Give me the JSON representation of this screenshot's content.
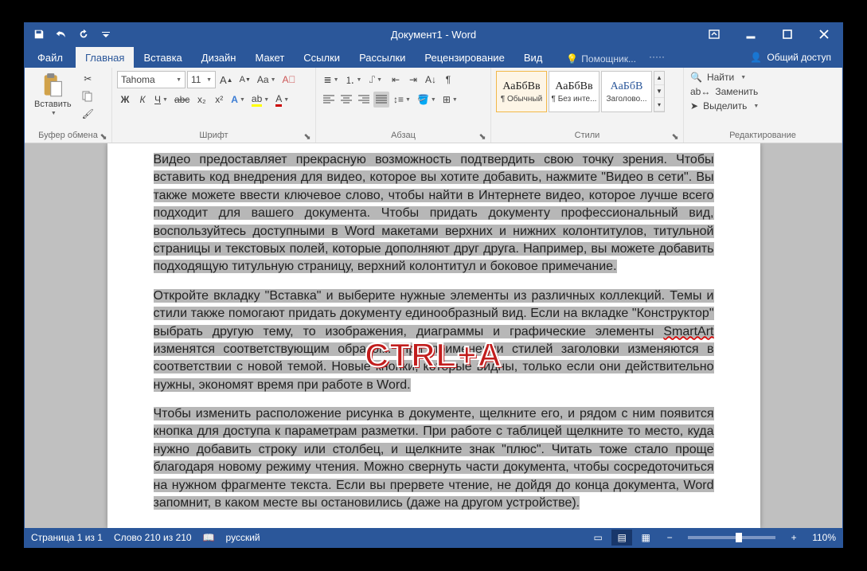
{
  "title": "Документ1 - Word",
  "tabs": {
    "file": "Файл",
    "home": "Главная",
    "insert": "Вставка",
    "design": "Дизайн",
    "layout": "Макет",
    "references": "Ссылки",
    "mailings": "Рассылки",
    "review": "Рецензирование",
    "view": "Вид"
  },
  "tellme": "Помощник...",
  "share": "Общий доступ",
  "ribbon": {
    "clipboard": {
      "label": "Буфер обмена",
      "paste": "Вставить"
    },
    "font": {
      "label": "Шрифт",
      "name": "Tahoma",
      "size": "11",
      "bold": "Ж",
      "italic": "К",
      "underline": "Ч",
      "strike": "abc",
      "sub": "x₂",
      "sup": "x²"
    },
    "paragraph": {
      "label": "Абзац"
    },
    "styles": {
      "label": "Стили",
      "items": [
        {
          "preview": "АаБбВв",
          "name": "¶ Обычный"
        },
        {
          "preview": "АаБбВв",
          "name": "¶ Без инте..."
        },
        {
          "preview": "АаБбВ",
          "name": "Заголово..."
        }
      ]
    },
    "editing": {
      "label": "Редактирование",
      "find": "Найти",
      "replace": "Заменить",
      "select": "Выделить"
    }
  },
  "document": {
    "p1": "Видео предоставляет прекрасную возможность подтвердить свою точку зрения. Чтобы вставить код внедрения для видео, которое вы хотите добавить, нажмите \"Видео в сети\". Вы также можете ввести ключевое слово, чтобы найти в Интернете видео, которое лучше всего подходит для вашего документа. Чтобы придать документу профессиональный вид, воспользуйтесь доступными в Word макетами верхних и нижних колонтитулов, титульной страницы и текстовых полей, которые дополняют друг друга. Например, вы можете добавить подходящую титульную страницу, верхний колонтитул и боковое примечание.",
    "p2a": "Откройте вкладку \"Вставка\" и выберите нужные элементы из различных коллекций. Темы и стили также помогают придать документу единообразный вид. Если на вкладке \"Конструктор\" выбрать другую тему, то изображения, диаграммы и графические элементы ",
    "p2b": " изменятся соответствующим образом. При применении стилей заголовки изменяются в соответствии с новой темой. Новые кнопки, которые видны, только если они действительно нужны, экономят время при работе в Word.",
    "smartart": "SmartArt",
    "p3": "Чтобы изменить расположение рисунка в документе, щелкните его, и рядом с ним появится кнопка для доступа к параметрам разметки. При работе с таблицей щелкните то место, куда нужно добавить строку или столбец, и щелкните знак \"плюс\". Читать тоже стало проще благодаря новому режиму чтения. Можно свернуть части документа, чтобы сосредоточиться на нужном фрагменте текста. Если вы прервете чтение, не дойдя до конца документа, Word запомнит, в каком месте вы остановились (даже на другом устройстве)."
  },
  "status": {
    "page": "Страница 1 из 1",
    "words": "Слово 210 из 210",
    "lang": "русский",
    "zoom": "110%"
  },
  "overlay": "CTRL+A"
}
